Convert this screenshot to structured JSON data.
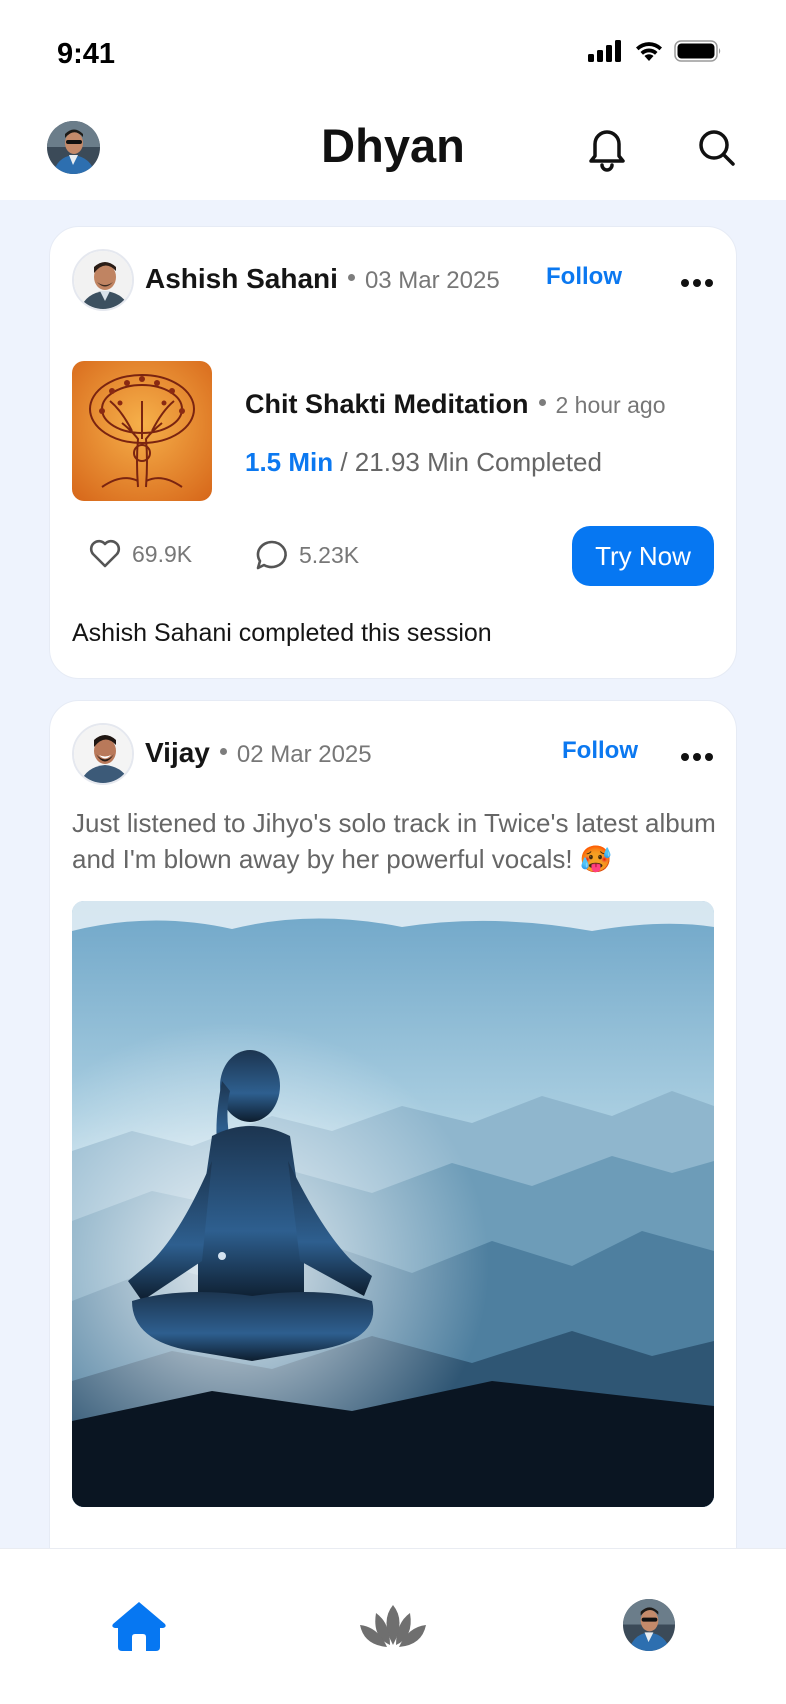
{
  "status_bar": {
    "time": "9:41"
  },
  "header": {
    "title": "Dhyan"
  },
  "posts": [
    {
      "author": "Ashish Sahani",
      "date": "03 Mar 2025",
      "follow_label": "Follow",
      "session": {
        "title": "Chit Shakti Meditation",
        "time_ago": "2 hour ago",
        "progress_done": "1.5 Min",
        "progress_rest": " / 21.93 Min Completed"
      },
      "likes": "69.9K",
      "comments": "5.23K",
      "cta_label": "Try Now",
      "activity": "Ashish Sahani completed this session"
    },
    {
      "author": "Vijay",
      "date": "02 Mar 2025",
      "follow_label": "Follow",
      "text": "Just listened to Jihyo's solo track in Twice's latest album and I'm blown away by her powerful vocals! 🥵"
    }
  ],
  "colors": {
    "accent": "#0677f2",
    "background": "#eef3fd",
    "muted": "#777777"
  },
  "icons": [
    "signal-icon",
    "wifi-icon",
    "battery-icon",
    "bell-icon",
    "search-icon",
    "more-icon",
    "heart-icon",
    "comment-icon",
    "home-icon",
    "lotus-icon"
  ]
}
